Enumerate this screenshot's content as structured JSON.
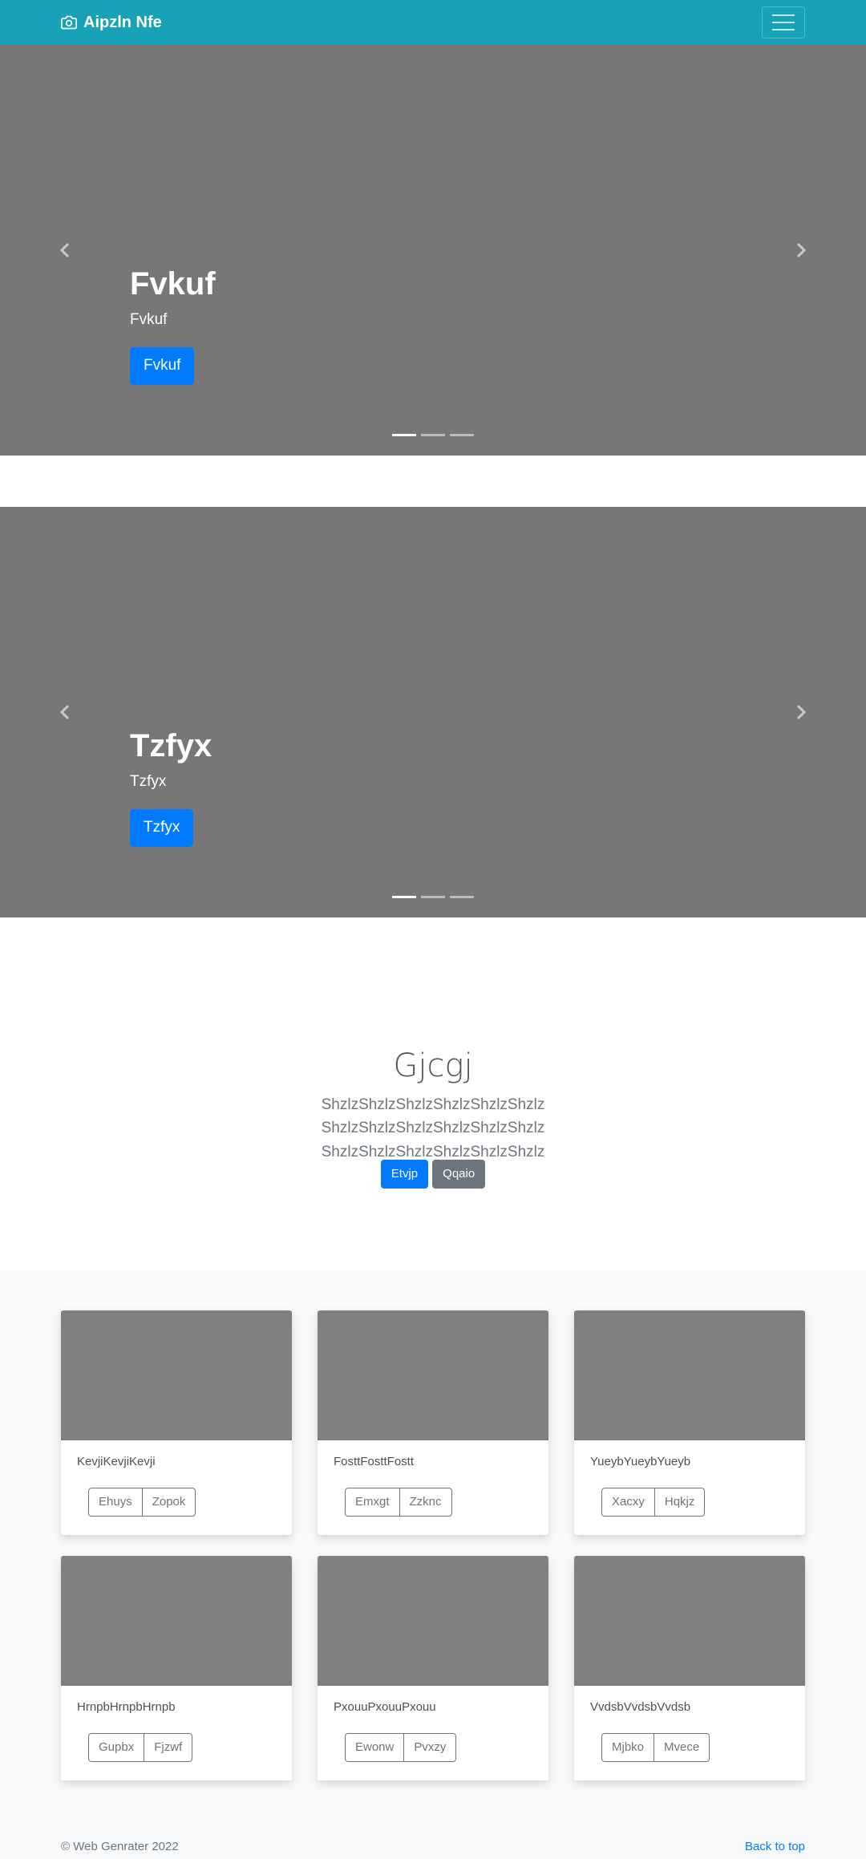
{
  "navbar": {
    "brand": "Aipzln Nfe",
    "brand_icon": "camera-icon",
    "toggler_icon": "hamburger-menu-icon",
    "bg_color": "#17a2b8"
  },
  "carousels": [
    {
      "title": "Fvkuf",
      "subtitle": "Fvkuf",
      "button": "Fvkuf",
      "active_indicator": 1,
      "indicator_count": 3
    },
    {
      "title": "Tzfyx",
      "subtitle": "Tzfyx",
      "button": "Tzfyx",
      "active_indicator": 1,
      "indicator_count": 3
    }
  ],
  "jumbotron": {
    "heading": "Gjcgj",
    "lead": "ShzlzShzlzShzlzShzlzShzlzShzlz ShzlzShzlzShzlzShzlzShzlzShzlz ShzlzShzlzShzlzShzlzShzlzShzlz",
    "primary_button": "Etvjp",
    "secondary_button": "Qqaio"
  },
  "cards": [
    {
      "text": "KevjiKevjiKevji",
      "btn1": "Ehuys",
      "btn2": "Zopok"
    },
    {
      "text": "FosttFosttFostt",
      "btn1": "Emxgt",
      "btn2": "Zzknc"
    },
    {
      "text": "YueybYueybYueyb",
      "btn1": "Xacxy",
      "btn2": "Hqkjz"
    },
    {
      "text": "HrnpbHrnpbHrnpb",
      "btn1": "Gupbx",
      "btn2": "Fjzwf"
    },
    {
      "text": "PxouuPxouuPxouu",
      "btn1": "Ewonw",
      "btn2": "Pvxzy"
    },
    {
      "text": "VvdsbVvdsbVvdsb",
      "btn1": "Mjbko",
      "btn2": "Mvece"
    }
  ],
  "footer": {
    "copyright": "© Web Genrater 2022",
    "back_to_top": "Back to top"
  },
  "colors": {
    "primary": "#007bff",
    "secondary": "#6c757d",
    "carousel_bg": "#777777",
    "card_thumb": "#808080"
  }
}
